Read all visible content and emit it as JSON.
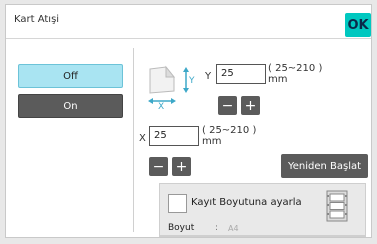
{
  "window": {
    "title": "Kart Atışi",
    "ok_label": "OK"
  },
  "mode": {
    "off_label": "Off",
    "on_label": "On",
    "selected": "Off"
  },
  "y_axis": {
    "label": "Y",
    "value": "25",
    "range": "( 25~210 )",
    "unit": "mm"
  },
  "x_axis": {
    "label": "X",
    "value": "25",
    "range": "( 25~210 )",
    "unit": "mm"
  },
  "stepper": {
    "minus": "−",
    "plus": "+"
  },
  "restart_label": "Yeniden Başlat",
  "fit": {
    "label": "Kayıt Boyutuna ayarla",
    "checked": false,
    "size_label": "Boyut",
    "size_colon": ":",
    "size_value": "A4"
  },
  "icons": {
    "card": "card-scan-xy-icon",
    "reel": "film-reel-icon"
  },
  "colors": {
    "accent": "#00c8c0",
    "selected_button": "#a9e4f2",
    "dark_button": "#5b5b5b",
    "icon_arrow": "#3da8c8"
  }
}
